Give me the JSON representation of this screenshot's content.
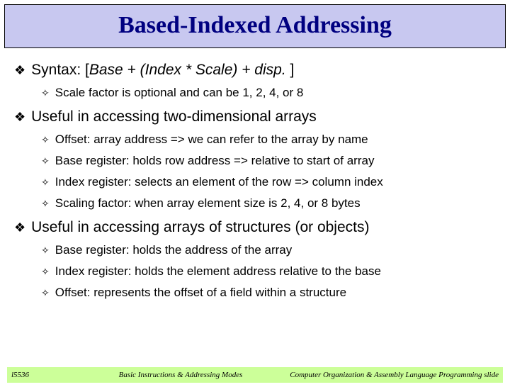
{
  "title": "Based-Indexed Addressing",
  "bullets": {
    "b1_pre": "Syntax: [",
    "b1_ital": "Base + (Index * Scale) + disp.",
    "b1_post": " ]",
    "b1a": "Scale factor is optional and can be 1, 2, 4, or 8",
    "b2": "Useful in accessing two-dimensional arrays",
    "b2a": "Offset: array address => we can refer to the array by name",
    "b2b": "Base register: holds row address => relative to start of array",
    "b2c": "Index register: selects an element of the row => column index",
    "b2d": "Scaling factor: when array element size is 2, 4, or 8 bytes",
    "b3": "Useful in accessing arrays of structures (or objects)",
    "b3a": "Base register: holds the address of the array",
    "b3b": "Index register: holds the element address relative to the base",
    "b3c": "Offset: represents the offset of a field within a structure"
  },
  "footer": {
    "left": "l5536",
    "center": "Basic Instructions & Addressing Modes",
    "right": "Computer Organization & Assembly Language Programming slide"
  }
}
